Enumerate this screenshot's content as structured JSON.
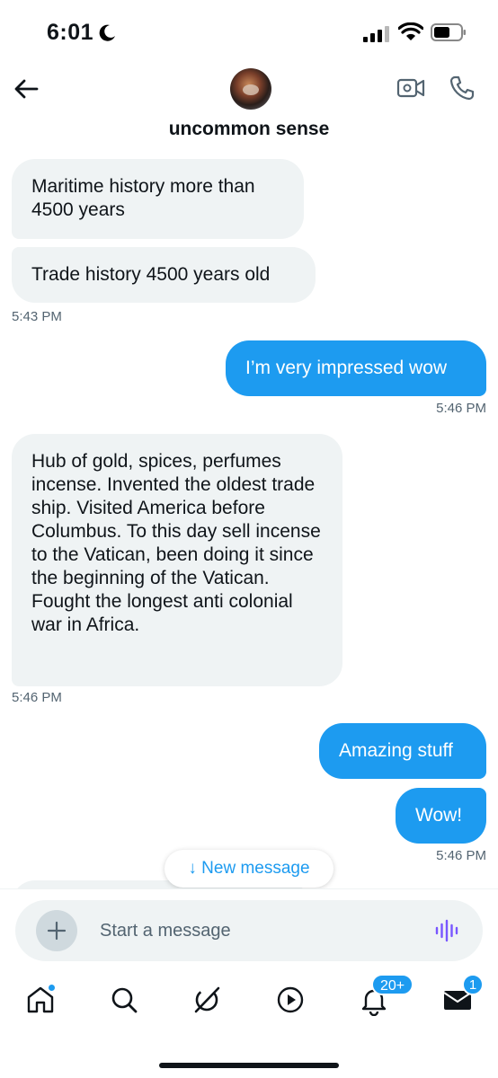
{
  "status_bar": {
    "time": "6:01"
  },
  "header": {
    "contact_name": "uncommon sense"
  },
  "messages": [
    {
      "id": "m1",
      "direction": "received",
      "text": "Maritime history more than 4500 years"
    },
    {
      "id": "m2",
      "direction": "received",
      "text": "Trade history 4500 years old"
    },
    {
      "id": "m3",
      "direction": "sent",
      "text": "I’m very impressed wow"
    },
    {
      "id": "m4",
      "direction": "received",
      "text": "Hub of gold, spices, perfumes incense. Invented the oldest trade ship. Visited America before Columbus. To this day sell incense to the Vatican, been doing it since the beginning of the Vatican. Fought the longest anti colonial war in Africa."
    },
    {
      "id": "m5",
      "direction": "sent",
      "text": "Amazing stuff"
    },
    {
      "id": "m6",
      "direction": "sent",
      "text": "Wow!"
    }
  ],
  "timestamps": [
    "5:43 PM",
    "5:46 PM",
    "5:46 PM",
    "5:46 PM"
  ],
  "new_message_pill": {
    "label": "↓ New message"
  },
  "composer": {
    "placeholder": "Start a message"
  },
  "tab_bar": {
    "items": [
      "home-icon",
      "search-icon",
      "grok-icon",
      "video-icon",
      "notifications-icon",
      "messages-icon"
    ],
    "notifications_badge": "20+",
    "messages_badge": "1"
  },
  "colors": {
    "accent": "#1d9bf0",
    "received_bubble": "#eff3f4",
    "secondary_text": "#536471",
    "voice_icon": "#7856ff"
  }
}
